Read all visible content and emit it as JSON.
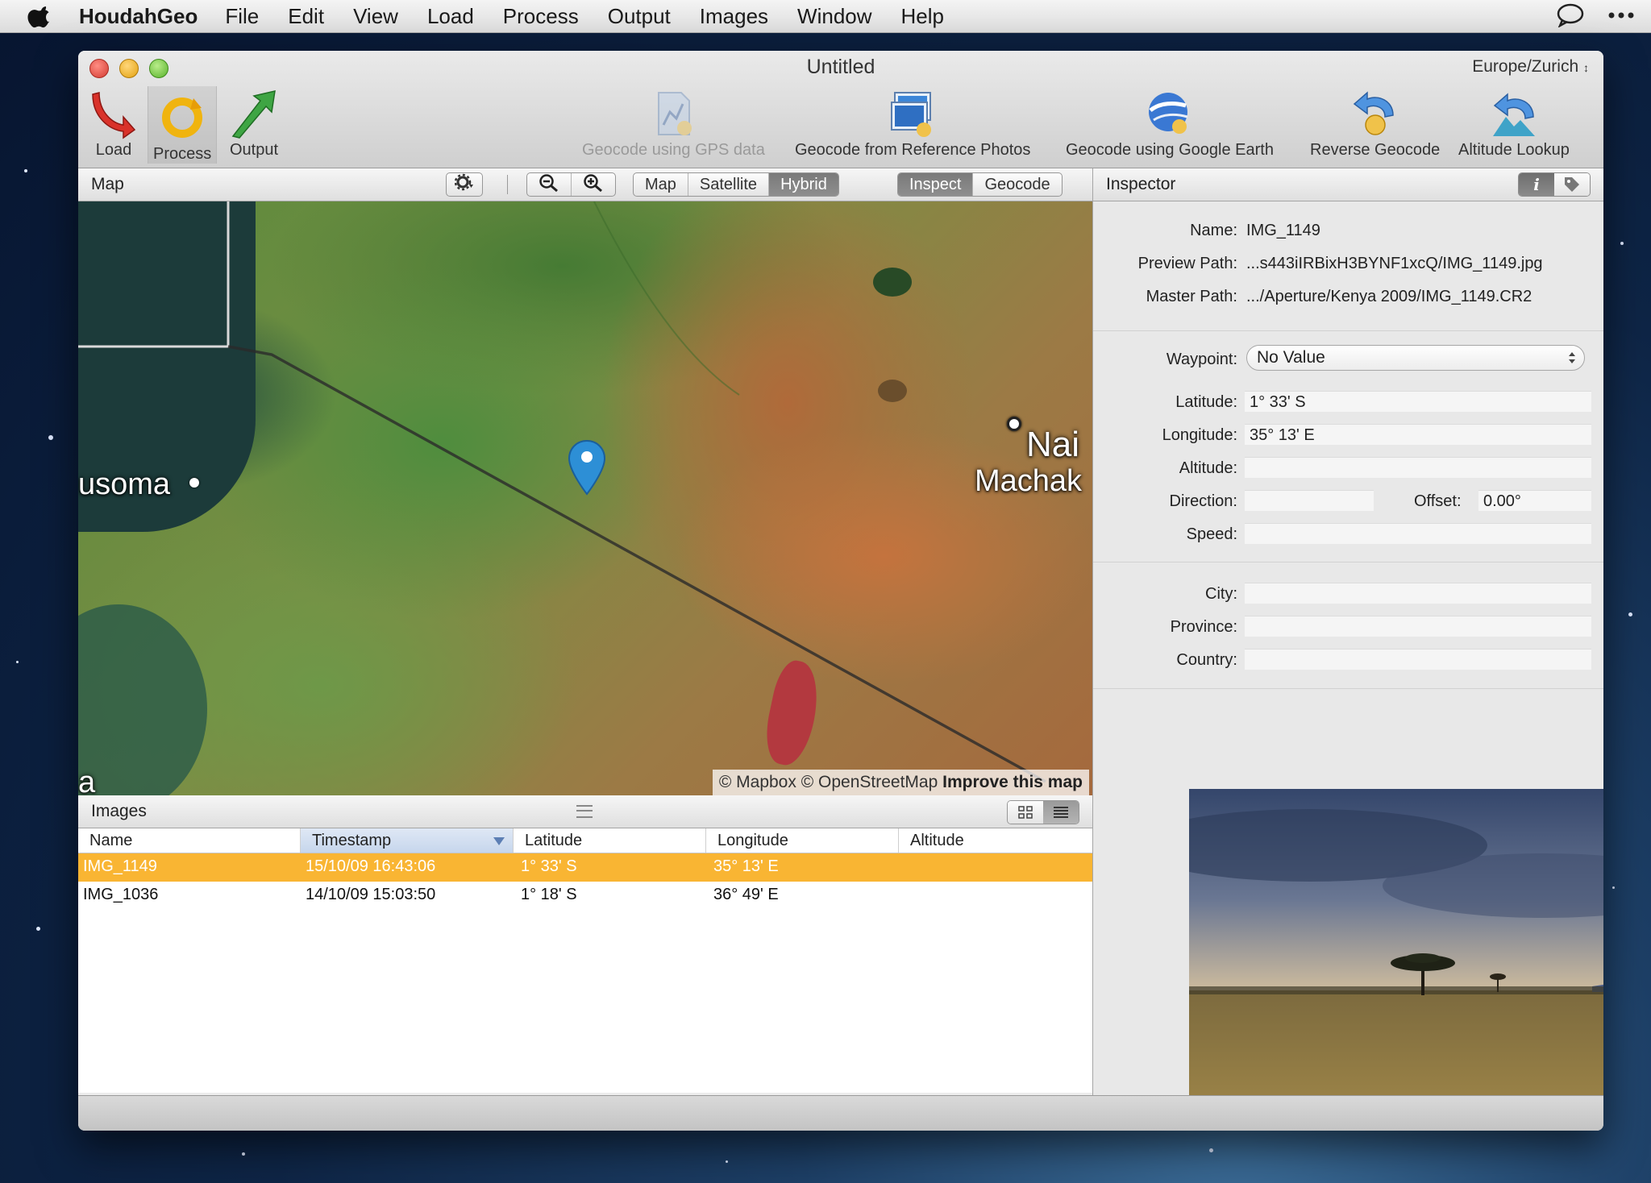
{
  "menubar": {
    "app": "HoudahGeo",
    "items": [
      "File",
      "Edit",
      "View",
      "Load",
      "Process",
      "Output",
      "Images",
      "Window",
      "Help"
    ]
  },
  "window": {
    "title": "Untitled",
    "timezone": "Europe/Zurich"
  },
  "toolbar": {
    "load": "Load",
    "process": "Process",
    "output": "Output",
    "geocode_gps": "Geocode using GPS data",
    "geocode_ref": "Geocode from Reference Photos",
    "geocode_earth": "Geocode using Google Earth",
    "reverse": "Reverse Geocode",
    "altitude": "Altitude Lookup"
  },
  "map": {
    "title": "Map",
    "modes": [
      "Map",
      "Satellite",
      "Hybrid"
    ],
    "active_mode": "Hybrid",
    "tabs": [
      "Inspect",
      "Geocode"
    ],
    "active_tab": "Inspect",
    "labels": {
      "musoma": "usoma",
      "nairobi": "Nai",
      "machakos": "Machak",
      "edge": "a"
    },
    "attribution": {
      "prefix": "© Mapbox © OpenStreetMap",
      "link": "Improve this map"
    }
  },
  "images": {
    "title": "Images",
    "columns": [
      "Name",
      "Timestamp",
      "Latitude",
      "Longitude",
      "Altitude"
    ],
    "sorted_column": "Timestamp",
    "rows": [
      {
        "name": "IMG_1149",
        "timestamp": "15/10/09 16:43:06",
        "latitude": "1° 33' S",
        "longitude": "35° 13' E",
        "altitude": "",
        "selected": true
      },
      {
        "name": "IMG_1036",
        "timestamp": "14/10/09 15:03:50",
        "latitude": "1° 18' S",
        "longitude": "36° 49' E",
        "altitude": "",
        "selected": false
      }
    ]
  },
  "inspector": {
    "title": "Inspector",
    "name_label": "Name:",
    "name": "IMG_1149",
    "preview_label": "Preview Path:",
    "preview_path": "...s443iIRBixH3BYNF1xcQ/IMG_1149.jpg",
    "master_label": "Master Path:",
    "master_path": ".../Aperture/Kenya 2009/IMG_1149.CR2",
    "waypoint_label": "Waypoint:",
    "waypoint": "No Value",
    "latitude_label": "Latitude:",
    "latitude": "1° 33' S",
    "longitude_label": "Longitude:",
    "longitude": "35° 13' E",
    "altitude_label": "Altitude:",
    "altitude": "",
    "direction_label": "Direction:",
    "direction": "",
    "offset_label": "Offset:",
    "offset": "0.00°",
    "speed_label": "Speed:",
    "speed": "",
    "city_label": "City:",
    "city": "",
    "province_label": "Province:",
    "province": "",
    "country_label": "Country:",
    "country": ""
  },
  "colors": {
    "selection": "#f9b533",
    "pin": "#2d8fd6"
  }
}
